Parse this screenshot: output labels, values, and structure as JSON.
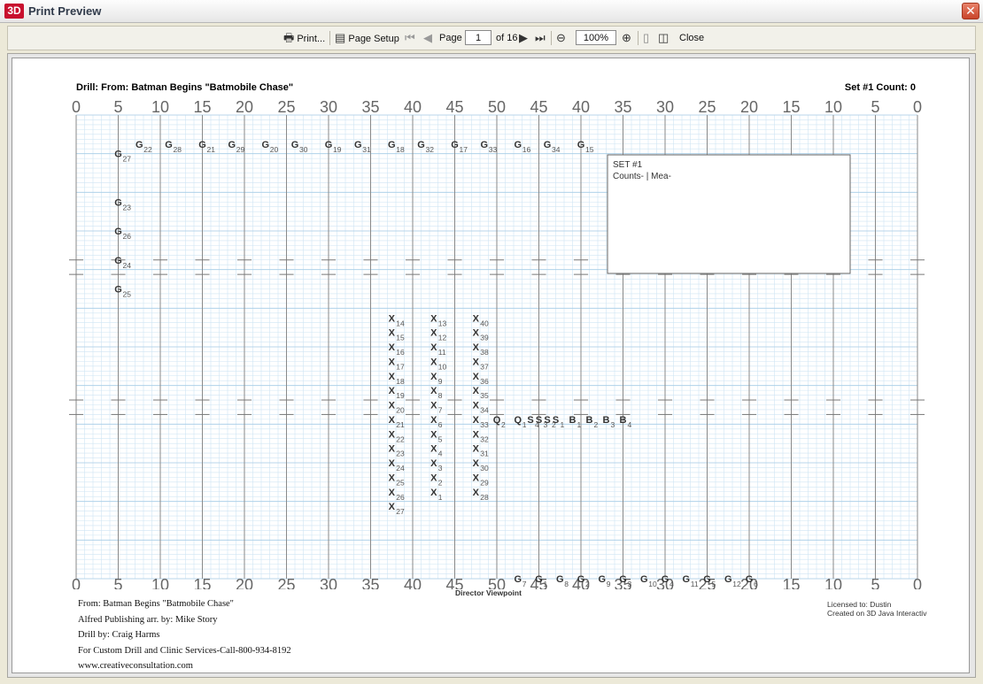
{
  "window": {
    "logo": "3D",
    "title": "Print Preview",
    "close_icon": "close-x-icon"
  },
  "toolbar": {
    "print": "Print...",
    "page_setup": "Page Setup",
    "page_label": "Page",
    "page_value": "1",
    "page_total": "of 16",
    "zoom_value": "100%",
    "close": "Close"
  },
  "sheet": {
    "drill_title": "Drill: From: Batman Begins \"Batmobile Chase\"",
    "set_count": "Set #1  Count: 0",
    "yard_labels": [
      "0",
      "5",
      "10",
      "15",
      "20",
      "25",
      "30",
      "35",
      "40",
      "45",
      "50",
      "45",
      "40",
      "35",
      "30",
      "25",
      "20",
      "15",
      "10",
      "5",
      "0"
    ],
    "set_box": {
      "line1": "SET #1",
      "line2": "Counts- | Mea-"
    },
    "viewpoint": "Director Viewpoint",
    "footer_lines": [
      "From: Batman Begins \"Batmobile Chase\"",
      "Alfred Publishing arr. by: Mike Story",
      "Drill by: Craig Harms",
      "For Custom Drill and Clinic Services-Call-800-934-8192",
      "www.creativeconsultation.com"
    ],
    "license_lines": [
      "Licensed to: Dustin",
      "Created on 3D Java Interactiv"
    ]
  },
  "chart_data": {
    "type": "scatter",
    "title": "Drill: From: Batman Begins \"Batmobile Chase\"",
    "x_axis": "yard line (0 to 100, left to right)",
    "y_axis": "field depth in 8-step units, front sideline = 0",
    "series": [
      {
        "name": "G",
        "points": [
          {
            "label": "27",
            "x": 5,
            "y": 44
          },
          {
            "label": "22",
            "x": 7.5,
            "y": 45
          },
          {
            "label": "28",
            "x": 11,
            "y": 45
          },
          {
            "label": "21",
            "x": 15,
            "y": 45
          },
          {
            "label": "29",
            "x": 18.5,
            "y": 45
          },
          {
            "label": "20",
            "x": 22.5,
            "y": 45
          },
          {
            "label": "30",
            "x": 26,
            "y": 45
          },
          {
            "label": "19",
            "x": 30,
            "y": 45
          },
          {
            "label": "31",
            "x": 33.5,
            "y": 45
          },
          {
            "label": "18",
            "x": 37.5,
            "y": 45
          },
          {
            "label": "32",
            "x": 41,
            "y": 45
          },
          {
            "label": "17",
            "x": 45,
            "y": 45
          },
          {
            "label": "33",
            "x": 48.5,
            "y": 45
          },
          {
            "label": "16",
            "x": 52.5,
            "y": 45
          },
          {
            "label": "34",
            "x": 56,
            "y": 45
          },
          {
            "label": "15",
            "x": 60,
            "y": 45
          },
          {
            "label": "23",
            "x": 5,
            "y": 39
          },
          {
            "label": "26",
            "x": 5,
            "y": 36
          },
          {
            "label": "24",
            "x": 5,
            "y": 33
          },
          {
            "label": "25",
            "x": 5,
            "y": 30
          },
          {
            "label": "1",
            "x": 55,
            "y": 0
          },
          {
            "label": "2",
            "x": 60,
            "y": 0
          },
          {
            "label": "3",
            "x": 65,
            "y": 0
          },
          {
            "label": "4",
            "x": 70,
            "y": 0
          },
          {
            "label": "5",
            "x": 75,
            "y": 0
          },
          {
            "label": "6",
            "x": 80,
            "y": 0
          },
          {
            "label": "7",
            "x": 52.5,
            "y": 0
          },
          {
            "label": "8",
            "x": 57.5,
            "y": 0
          },
          {
            "label": "9",
            "x": 62.5,
            "y": 0
          },
          {
            "label": "10",
            "x": 67.5,
            "y": 0
          },
          {
            "label": "11",
            "x": 72.5,
            "y": 0
          },
          {
            "label": "12",
            "x": 77.5,
            "y": 0
          }
        ]
      },
      {
        "name": "X",
        "points": [
          {
            "label": "14",
            "x": 37.5,
            "y": 27
          },
          {
            "label": "15",
            "x": 37.5,
            "y": 25.5
          },
          {
            "label": "16",
            "x": 37.5,
            "y": 24
          },
          {
            "label": "17",
            "x": 37.5,
            "y": 22.5
          },
          {
            "label": "18",
            "x": 37.5,
            "y": 21
          },
          {
            "label": "19",
            "x": 37.5,
            "y": 19.5
          },
          {
            "label": "20",
            "x": 37.5,
            "y": 18
          },
          {
            "label": "21",
            "x": 37.5,
            "y": 16.5
          },
          {
            "label": "22",
            "x": 37.5,
            "y": 15
          },
          {
            "label": "23",
            "x": 37.5,
            "y": 13.5
          },
          {
            "label": "24",
            "x": 37.5,
            "y": 12
          },
          {
            "label": "25",
            "x": 37.5,
            "y": 10.5
          },
          {
            "label": "26",
            "x": 37.5,
            "y": 9
          },
          {
            "label": "27",
            "x": 37.5,
            "y": 7.5
          },
          {
            "label": "13",
            "x": 42.5,
            "y": 27
          },
          {
            "label": "12",
            "x": 42.5,
            "y": 25.5
          },
          {
            "label": "11",
            "x": 42.5,
            "y": 24
          },
          {
            "label": "10",
            "x": 42.5,
            "y": 22.5
          },
          {
            "label": "9",
            "x": 42.5,
            "y": 21
          },
          {
            "label": "8",
            "x": 42.5,
            "y": 19.5
          },
          {
            "label": "7",
            "x": 42.5,
            "y": 18
          },
          {
            "label": "6",
            "x": 42.5,
            "y": 16.5
          },
          {
            "label": "5",
            "x": 42.5,
            "y": 15
          },
          {
            "label": "4",
            "x": 42.5,
            "y": 13.5
          },
          {
            "label": "3",
            "x": 42.5,
            "y": 12
          },
          {
            "label": "2",
            "x": 42.5,
            "y": 10.5
          },
          {
            "label": "1",
            "x": 42.5,
            "y": 9
          },
          {
            "label": "40",
            "x": 47.5,
            "y": 27
          },
          {
            "label": "39",
            "x": 47.5,
            "y": 25.5
          },
          {
            "label": "38",
            "x": 47.5,
            "y": 24
          },
          {
            "label": "37",
            "x": 47.5,
            "y": 22.5
          },
          {
            "label": "36",
            "x": 47.5,
            "y": 21
          },
          {
            "label": "35",
            "x": 47.5,
            "y": 19.5
          },
          {
            "label": "34",
            "x": 47.5,
            "y": 18
          },
          {
            "label": "33",
            "x": 47.5,
            "y": 16.5
          },
          {
            "label": "32",
            "x": 47.5,
            "y": 15
          },
          {
            "label": "31",
            "x": 47.5,
            "y": 13.5
          },
          {
            "label": "30",
            "x": 47.5,
            "y": 12
          },
          {
            "label": "29",
            "x": 47.5,
            "y": 10.5
          },
          {
            "label": "28",
            "x": 47.5,
            "y": 9
          }
        ]
      },
      {
        "name": "Q",
        "points": [
          {
            "label": "2",
            "x": 50,
            "y": 16.5
          },
          {
            "label": "1",
            "x": 52.5,
            "y": 16.5
          }
        ]
      },
      {
        "name": "S",
        "points": [
          {
            "label": "4",
            "x": 54,
            "y": 16.5
          },
          {
            "label": "3",
            "x": 55,
            "y": 16.5
          },
          {
            "label": "2",
            "x": 56,
            "y": 16.5
          },
          {
            "label": "1",
            "x": 57,
            "y": 16.5
          }
        ]
      },
      {
        "name": "B",
        "points": [
          {
            "label": "1",
            "x": 59,
            "y": 16.5
          },
          {
            "label": "2",
            "x": 61,
            "y": 16.5
          },
          {
            "label": "3",
            "x": 63,
            "y": 16.5
          },
          {
            "label": "4",
            "x": 65,
            "y": 16.5
          }
        ]
      }
    ]
  },
  "colors": {
    "grid_minor": "#cfe5f3",
    "grid_major": "#8a8a8a",
    "paper": "#ffffff",
    "marker": "#333333"
  }
}
